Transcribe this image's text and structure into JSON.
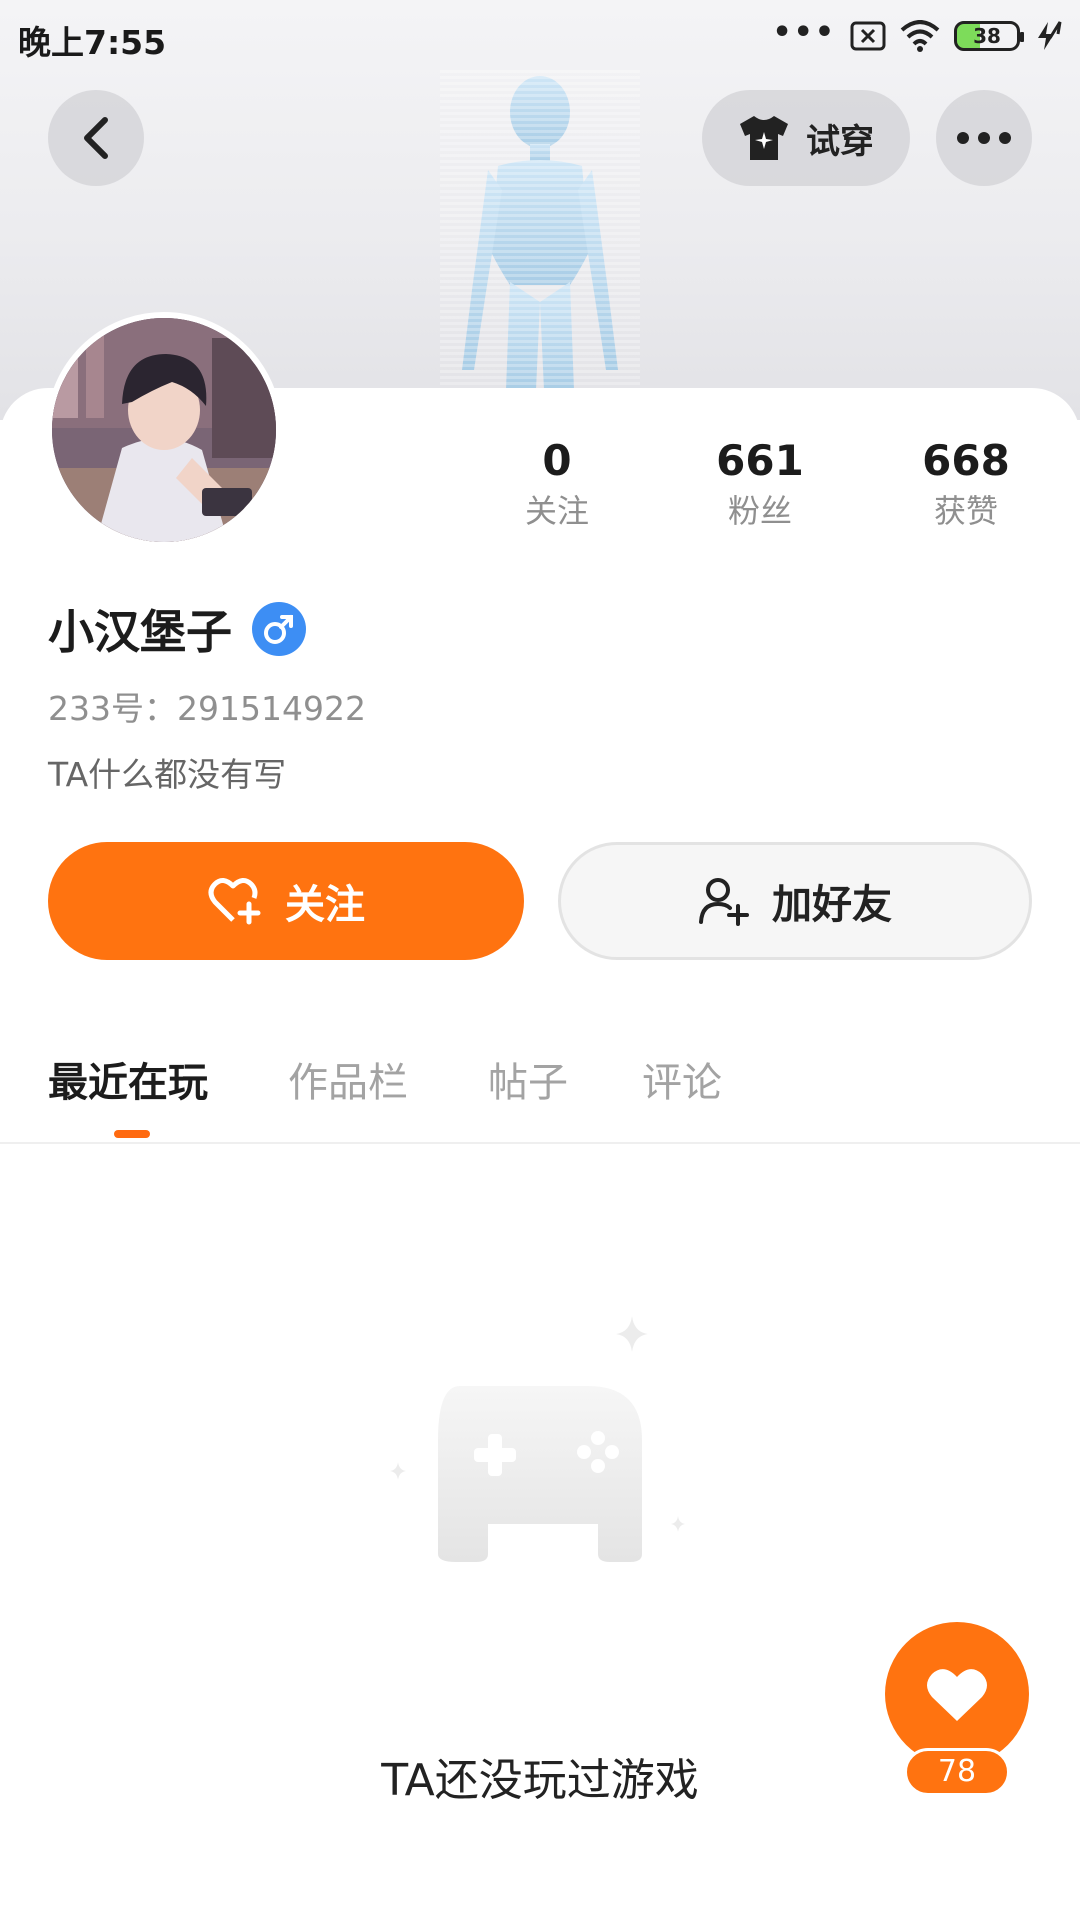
{
  "status_bar": {
    "time": "晚上7:55",
    "dots": "•••",
    "battery_level": "38"
  },
  "header": {
    "try_on_label": "试穿"
  },
  "stats": [
    {
      "value": "0",
      "label": "关注"
    },
    {
      "value": "661",
      "label": "粉丝"
    },
    {
      "value": "668",
      "label": "获赞"
    }
  ],
  "profile": {
    "name": "小汉堡子",
    "gender": "male",
    "id_text": "233号：291514922",
    "bio": "TA什么都没有写"
  },
  "actions": {
    "follow_label": "关注",
    "add_friend_label": "加好友"
  },
  "tabs": [
    "最近在玩",
    "作品栏",
    "帖子",
    "评论"
  ],
  "active_tab": "最近在玩",
  "empty_state": {
    "text": "TA还没玩过游戏"
  },
  "like": {
    "count": "78"
  },
  "colors": {
    "accent": "#ff7310",
    "gender_badge": "#3d8ef4"
  },
  "icons": [
    "back-icon",
    "shirt-icon",
    "more-icon",
    "heart-plus-icon",
    "user-plus-icon",
    "heart-icon",
    "wifi-icon",
    "male-icon"
  ]
}
